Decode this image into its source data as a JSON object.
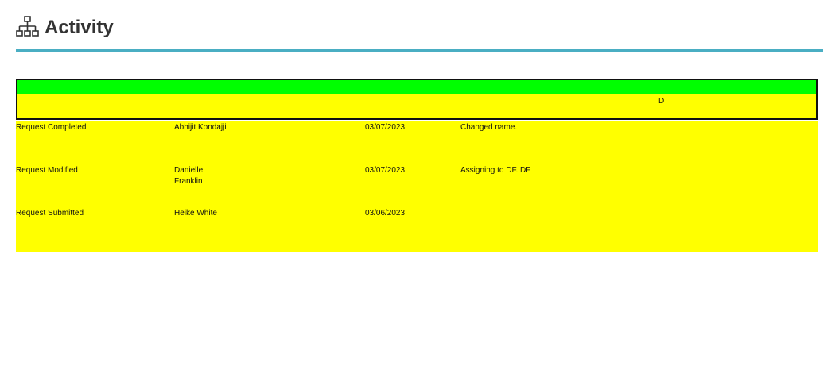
{
  "header": {
    "title": "Activity",
    "icon": "org-chart-icon"
  },
  "table": {
    "header_column_label": "D",
    "colors": {
      "header_band": "#00ff00",
      "row_background": "#ffff00",
      "rule": "#4aaec3"
    },
    "rows": [
      {
        "event": "Request Completed",
        "user": "Abhijit Kondajji",
        "date": "03/07/2023",
        "note": "Changed name."
      },
      {
        "event": "Request Modified",
        "user": "Danielle Franklin",
        "date": "03/07/2023",
        "note": "Assigning to DF. DF"
      },
      {
        "event": "Request Submitted",
        "user": "Heike White",
        "date": "03/06/2023",
        "note": ""
      }
    ]
  }
}
